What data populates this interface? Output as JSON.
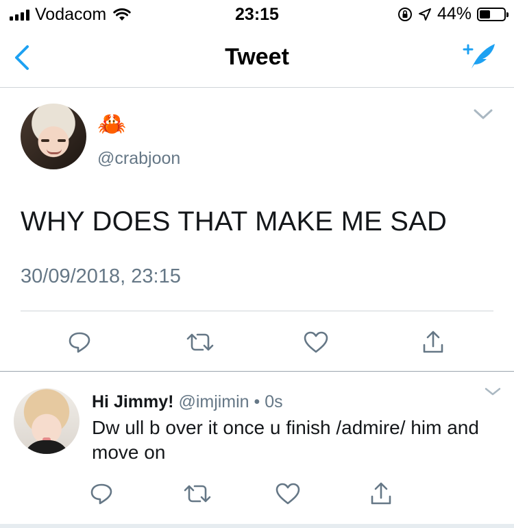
{
  "status_bar": {
    "carrier": "Vodacom",
    "time": "23:15",
    "battery_percent": "44%",
    "battery_level": 0.44,
    "icons": [
      "signal-icon",
      "wifi-icon",
      "orientation-lock-icon",
      "location-icon",
      "battery-icon"
    ]
  },
  "nav": {
    "title": "Tweet",
    "back_icon": "chevron-left-icon",
    "compose_icon": "compose-tweet-icon"
  },
  "tweet": {
    "display_name": "🦀",
    "handle": "@crabjoon",
    "text": "WHY DOES THAT MAKE ME SAD",
    "timestamp": "30/09/2018, 23:15",
    "actions": [
      "reply-icon",
      "retweet-icon",
      "like-icon",
      "share-icon"
    ]
  },
  "reply": {
    "display_name": "Hi Jimmy!",
    "handle": "@imjimin",
    "separator": "•",
    "age": "0s",
    "text": "Dw ull b over it once u finish /admire/ him and move on",
    "actions": [
      "reply-icon",
      "retweet-icon",
      "like-icon",
      "share-icon"
    ]
  },
  "colors": {
    "accent": "#1da1f2",
    "icon_gray": "#657786",
    "text": "#14171a",
    "divider": "#cfd4d9"
  }
}
